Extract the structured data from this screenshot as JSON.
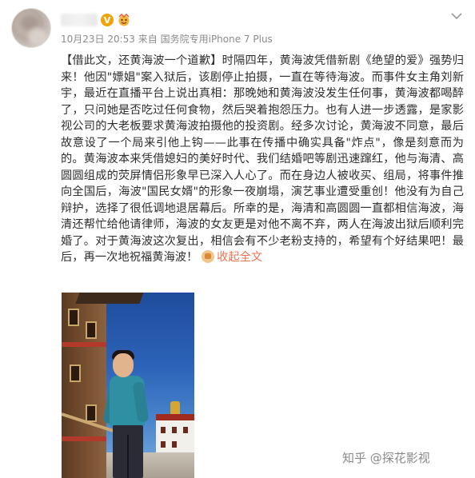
{
  "header": {
    "timestamp": "10月23日 20:53",
    "source_prefix": "来自",
    "source": "国务院专用iPhone 7 Plus",
    "verified_mark": "V"
  },
  "post": {
    "tag": "【借此文，还黄海波一个道歉】",
    "body": "时隔四年，黄海波凭借新剧《绝望的爱》强势归来！他因\"嫖娼\"案入狱后，该剧停止拍摄，一直在等待海波。而事件女主角刘新宇，最近在直播平台上说出真相：那晚她和黄海波没发生任何事，黄海波都喝醉了，只问她是否吃过任何食物，然后哭着抱怨压力。也有人进一步透露，是家影视公司的大老板要求黄海波拍摄他的投资剧。经多次讨论，黄海波不同意，最后故意设了一个局来引他上钩——此事在传播中确实具备\"炸点\"，像是刻意而为的。黄海波本来凭借媳妇的美好时代、我们结婚吧等剧迅速蹿红，他与海清、高圆圆组成的荧屏情侣形象早已深入人心了。而在身边人被收买、组局，将事件推向全国后，海波\"国民女婿\"的形象一夜崩塌，演艺事业遭受重创！他没有为自己辩护，选择了很低调地退居幕后。所幸的是，海清和高圆圆一直都相信海波，海清还帮忙给他请律师，海波的女友更是对他不离不弃，两人在海波出狱后顺利完婚了。对于黄海波这次复出，相信会有不少老粉支持的，希望有个好结果吧！最后，再一次地祝福黄海波！",
    "collapse_label": "收起全文"
  },
  "watermark": "知乎 @探花影视",
  "colors": {
    "link_orange": "#eb7350",
    "meta_gray": "#8b8b8b",
    "verified_badge": "#f0a30a"
  },
  "icons": [
    "avatar",
    "verified-icon",
    "vip-icon",
    "chevron-down-icon",
    "collapse-icon"
  ]
}
